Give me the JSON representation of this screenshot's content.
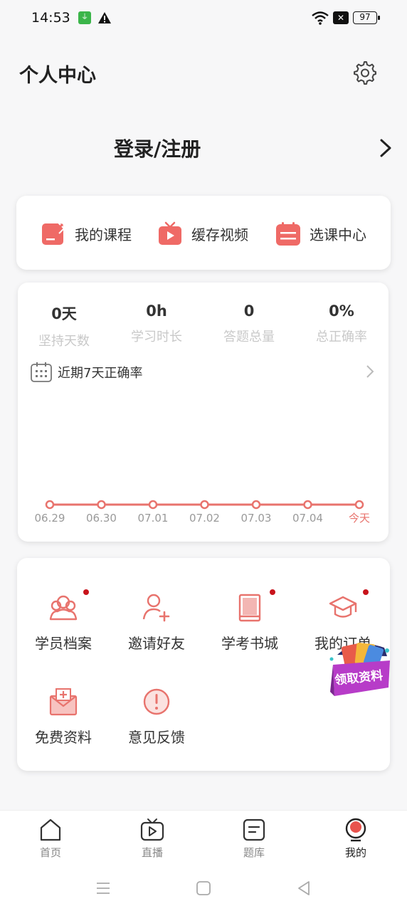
{
  "status_bar": {
    "time": "14:53",
    "battery": "97"
  },
  "header": {
    "title": "个人中心"
  },
  "login": {
    "label": "登录/注册"
  },
  "shortcuts": [
    {
      "label": "我的课程",
      "icon": "edit-note-icon"
    },
    {
      "label": "缓存视频",
      "icon": "tv-play-icon"
    },
    {
      "label": "选课中心",
      "icon": "calendar-list-icon"
    }
  ],
  "stats": [
    {
      "value": "0天",
      "caption": "坚持天数"
    },
    {
      "value": "0h",
      "caption": "学习时长"
    },
    {
      "value": "0",
      "caption": "答题总量"
    },
    {
      "value": "0%",
      "caption": "总正确率"
    }
  ],
  "recent": {
    "label": "近期7天正确率"
  },
  "chart_data": {
    "type": "line",
    "categories": [
      "06.29",
      "06.30",
      "07.01",
      "07.02",
      "07.03",
      "07.04",
      "今天"
    ],
    "values": [
      0,
      0,
      0,
      0,
      0,
      0,
      0
    ],
    "title": "",
    "xlabel": "",
    "ylabel": "",
    "ylim": [
      0,
      100
    ],
    "color": "#e8736d",
    "highlight_color": "#e8736d"
  },
  "tools": [
    {
      "label": "学员档案",
      "icon": "users-icon",
      "dot": true
    },
    {
      "label": "邀请好友",
      "icon": "add-user-icon",
      "dot": false
    },
    {
      "label": "学考书城",
      "icon": "book-icon",
      "dot": true
    },
    {
      "label": "我的订单",
      "icon": "graduation-cap-icon",
      "dot": true
    },
    {
      "label": "免费资料",
      "icon": "envelope-plus-icon",
      "dot": false
    },
    {
      "label": "意见反馈",
      "icon": "exclamation-icon",
      "dot": false
    }
  ],
  "promo": {
    "label": "领取资料"
  },
  "bottom_nav": [
    {
      "label": "首页",
      "icon": "home-icon"
    },
    {
      "label": "直播",
      "icon": "live-tv-icon"
    },
    {
      "label": "题库",
      "icon": "question-bank-icon"
    },
    {
      "label": "我的",
      "icon": "profile-avatar-icon"
    }
  ],
  "colors": {
    "accent": "#e8736d",
    "dot": "#c8131b",
    "background": "#f7f7f8"
  }
}
